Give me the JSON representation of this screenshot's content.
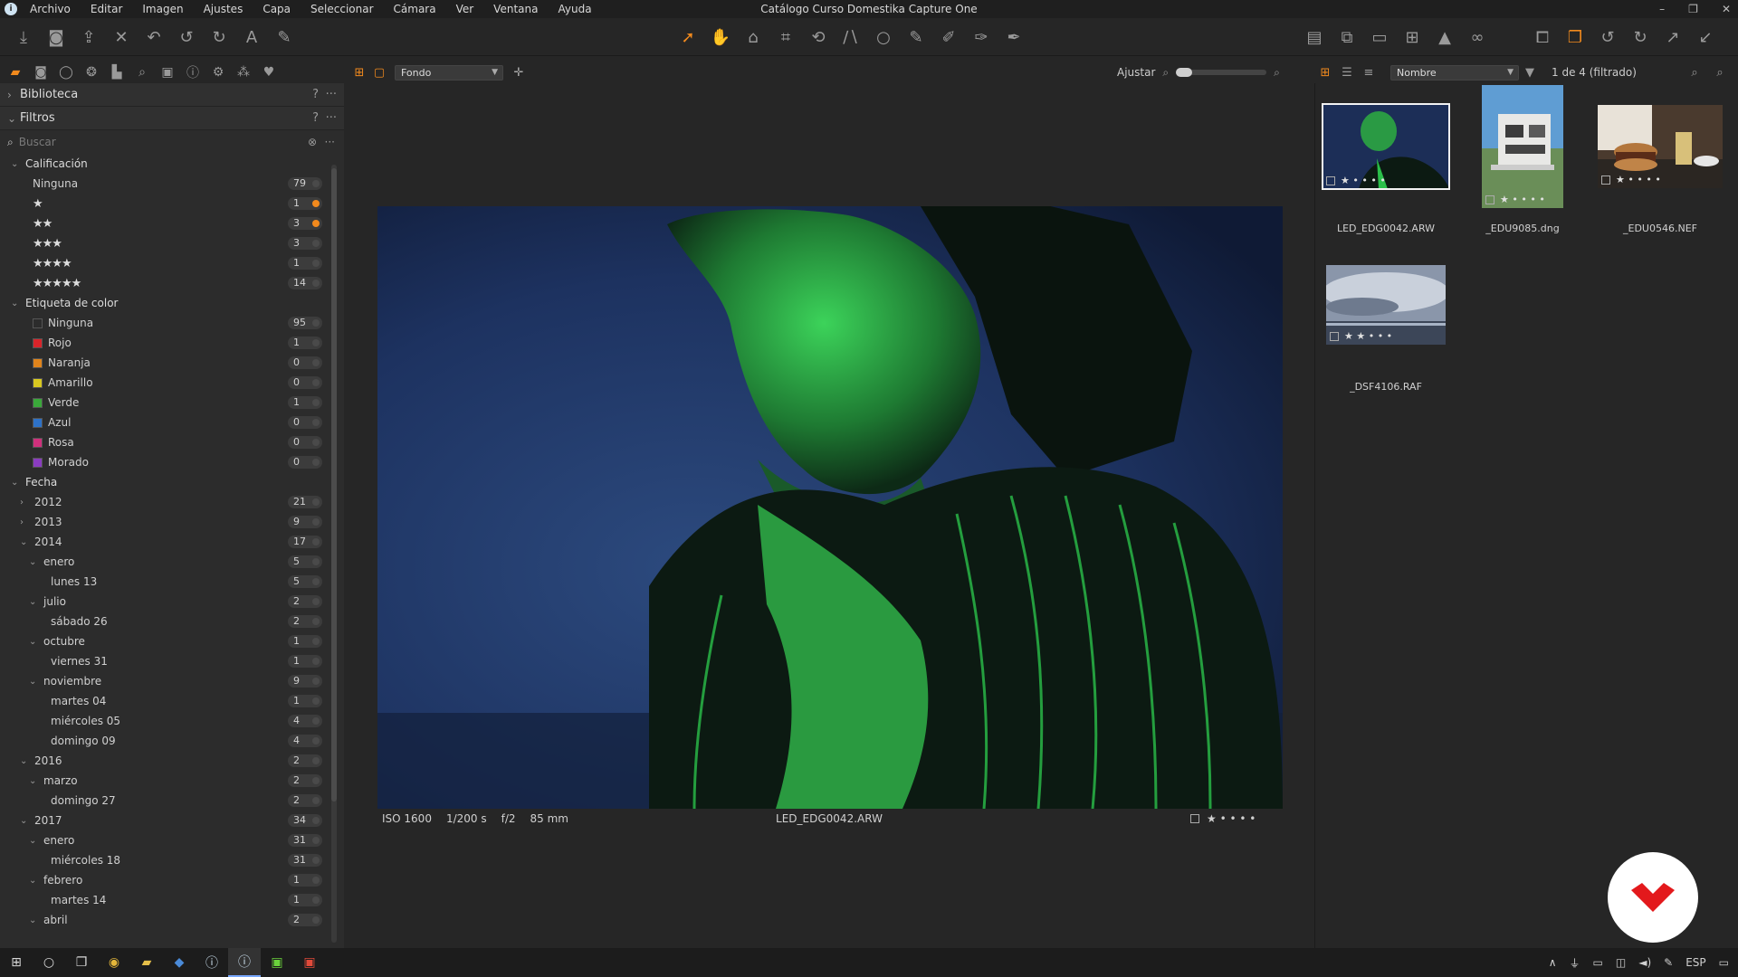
{
  "window": {
    "title": "Catálogo Curso Domestika Capture One",
    "menu": [
      "Archivo",
      "Editar",
      "Imagen",
      "Ajustes",
      "Capa",
      "Seleccionar",
      "Cámara",
      "Ver",
      "Ventana",
      "Ayuda"
    ],
    "controls": [
      "–",
      "❐",
      "✕"
    ]
  },
  "toolbar": {
    "left_icons": [
      "import-icon",
      "capture-icon",
      "export-icon",
      "delete-icon",
      "undo-icon",
      "undo-back-icon",
      "redo-icon",
      "text-icon",
      "edit-icon"
    ],
    "center_icons": [
      "select-cursor-icon",
      "pan-hand-icon",
      "loupe-icon",
      "crop-icon",
      "rotate-icon",
      "keystone-icon",
      "spot-icon",
      "brush-icon",
      "eraser-icon",
      "gradient-icon",
      "picker-icon"
    ],
    "right_icons": [
      "viewer-icon",
      "browser-icon",
      "monitor-icon",
      "grid-icon",
      "exposure-warning-icon",
      "proof-icon",
      "compare-icon",
      "layers-icon",
      "rotate-left-icon",
      "rotate-right-icon",
      "expand-icon",
      "collapse-icon"
    ]
  },
  "tool_tabs": [
    "library-tab",
    "capture-tab",
    "lens-tab",
    "color-tab",
    "exposure-tab",
    "details-tab",
    "local-tab",
    "metadata-tab",
    "output-tab",
    "batch-tab",
    "favorites-tab"
  ],
  "left_panel": {
    "biblioteca": {
      "label": "Biblioteca",
      "help": "?",
      "more": "···"
    },
    "filtros": {
      "label": "Filtros",
      "help": "?",
      "more": "···"
    },
    "search_placeholder": "Buscar",
    "calificacion": {
      "label": "Calificación",
      "rows": [
        {
          "label": "Ninguna",
          "stars": "",
          "count": "79",
          "dot": "none"
        },
        {
          "label": "",
          "stars": "★",
          "count": "1",
          "dot": "orange"
        },
        {
          "label": "",
          "stars": "★★",
          "count": "3",
          "dot": "orange"
        },
        {
          "label": "",
          "stars": "★★★",
          "count": "3",
          "dot": "none"
        },
        {
          "label": "",
          "stars": "★★★★",
          "count": "1",
          "dot": "none"
        },
        {
          "label": "",
          "stars": "★★★★★",
          "count": "14",
          "dot": "none"
        }
      ]
    },
    "etiqueta": {
      "label": "Etiqueta de color",
      "rows": [
        {
          "label": "Ninguna",
          "color": "#2c2c2c",
          "count": "95"
        },
        {
          "label": "Rojo",
          "color": "#d9242a",
          "count": "1"
        },
        {
          "label": "Naranja",
          "color": "#e0841c",
          "count": "0"
        },
        {
          "label": "Amarillo",
          "color": "#d8c820",
          "count": "0"
        },
        {
          "label": "Verde",
          "color": "#3aa83a",
          "count": "1"
        },
        {
          "label": "Azul",
          "color": "#2e72c8",
          "count": "0"
        },
        {
          "label": "Rosa",
          "color": "#d0307c",
          "count": "0"
        },
        {
          "label": "Morado",
          "color": "#8a3cc0",
          "count": "0"
        }
      ]
    },
    "fecha": {
      "label": "Fecha",
      "rows": [
        {
          "label": "2012",
          "level": 1,
          "chev": "›",
          "count": "21"
        },
        {
          "label": "2013",
          "level": 1,
          "chev": "›",
          "count": "9"
        },
        {
          "label": "2014",
          "level": 1,
          "chev": "⌄",
          "count": "17"
        },
        {
          "label": "enero",
          "level": 2,
          "chev": "⌄",
          "count": "5"
        },
        {
          "label": "lunes 13",
          "level": 3,
          "chev": "",
          "count": "5"
        },
        {
          "label": "julio",
          "level": 2,
          "chev": "⌄",
          "count": "2"
        },
        {
          "label": "sábado 26",
          "level": 3,
          "chev": "",
          "count": "2"
        },
        {
          "label": "octubre",
          "level": 2,
          "chev": "⌄",
          "count": "1"
        },
        {
          "label": "viernes 31",
          "level": 3,
          "chev": "",
          "count": "1"
        },
        {
          "label": "noviembre",
          "level": 2,
          "chev": "⌄",
          "count": "9"
        },
        {
          "label": "martes 04",
          "level": 3,
          "chev": "",
          "count": "1"
        },
        {
          "label": "miércoles 05",
          "level": 3,
          "chev": "",
          "count": "4"
        },
        {
          "label": "domingo 09",
          "level": 3,
          "chev": "",
          "count": "4"
        },
        {
          "label": "2016",
          "level": 1,
          "chev": "⌄",
          "count": "2"
        },
        {
          "label": "marzo",
          "level": 2,
          "chev": "⌄",
          "count": "2"
        },
        {
          "label": "domingo 27",
          "level": 3,
          "chev": "",
          "count": "2"
        },
        {
          "label": "2017",
          "level": 1,
          "chev": "⌄",
          "count": "34"
        },
        {
          "label": "enero",
          "level": 2,
          "chev": "⌄",
          "count": "31"
        },
        {
          "label": "miércoles 18",
          "level": 3,
          "chev": "",
          "count": "31"
        },
        {
          "label": "febrero",
          "level": 2,
          "chev": "⌄",
          "count": "1"
        },
        {
          "label": "martes 14",
          "level": 3,
          "chev": "",
          "count": "1"
        },
        {
          "label": "abril",
          "level": 2,
          "chev": "⌄",
          "count": "2"
        }
      ]
    }
  },
  "viewer": {
    "background_select": "Fondo",
    "fit_label": "Ajustar",
    "iso": "ISO 1600",
    "shutter": "1/200 s",
    "aperture": "f/2",
    "focal": "85 mm",
    "filename": "LED_EDG0042.ARW",
    "rating": "★ • • • •"
  },
  "browser": {
    "sort_label": "Nombre",
    "count_label": "1 de 4 (filtrado)",
    "items": [
      {
        "name": "LED_EDG0042.ARW",
        "rating": "★ • • • •",
        "selected": true
      },
      {
        "name": "_EDU9085.dng",
        "rating": "★ • • • •",
        "selected": false
      },
      {
        "name": "_EDU0546.NEF",
        "rating": "★ • • • •",
        "selected": false
      },
      {
        "name": "_DSF4106.RAF",
        "rating": "★ ★ • • •",
        "selected": false
      }
    ]
  },
  "taskbar": {
    "icons": [
      "start-icon",
      "search-circle-icon",
      "task-view-icon",
      "chrome-icon",
      "files-icon",
      "outlook-icon",
      "captureone-icon",
      "captureone-active-icon",
      "green-app-icon",
      "red-app-icon"
    ],
    "lang": "ESP"
  },
  "colors": {
    "accent": "#f28a1d",
    "panel": "#2c2c2c",
    "background": "#262626"
  }
}
